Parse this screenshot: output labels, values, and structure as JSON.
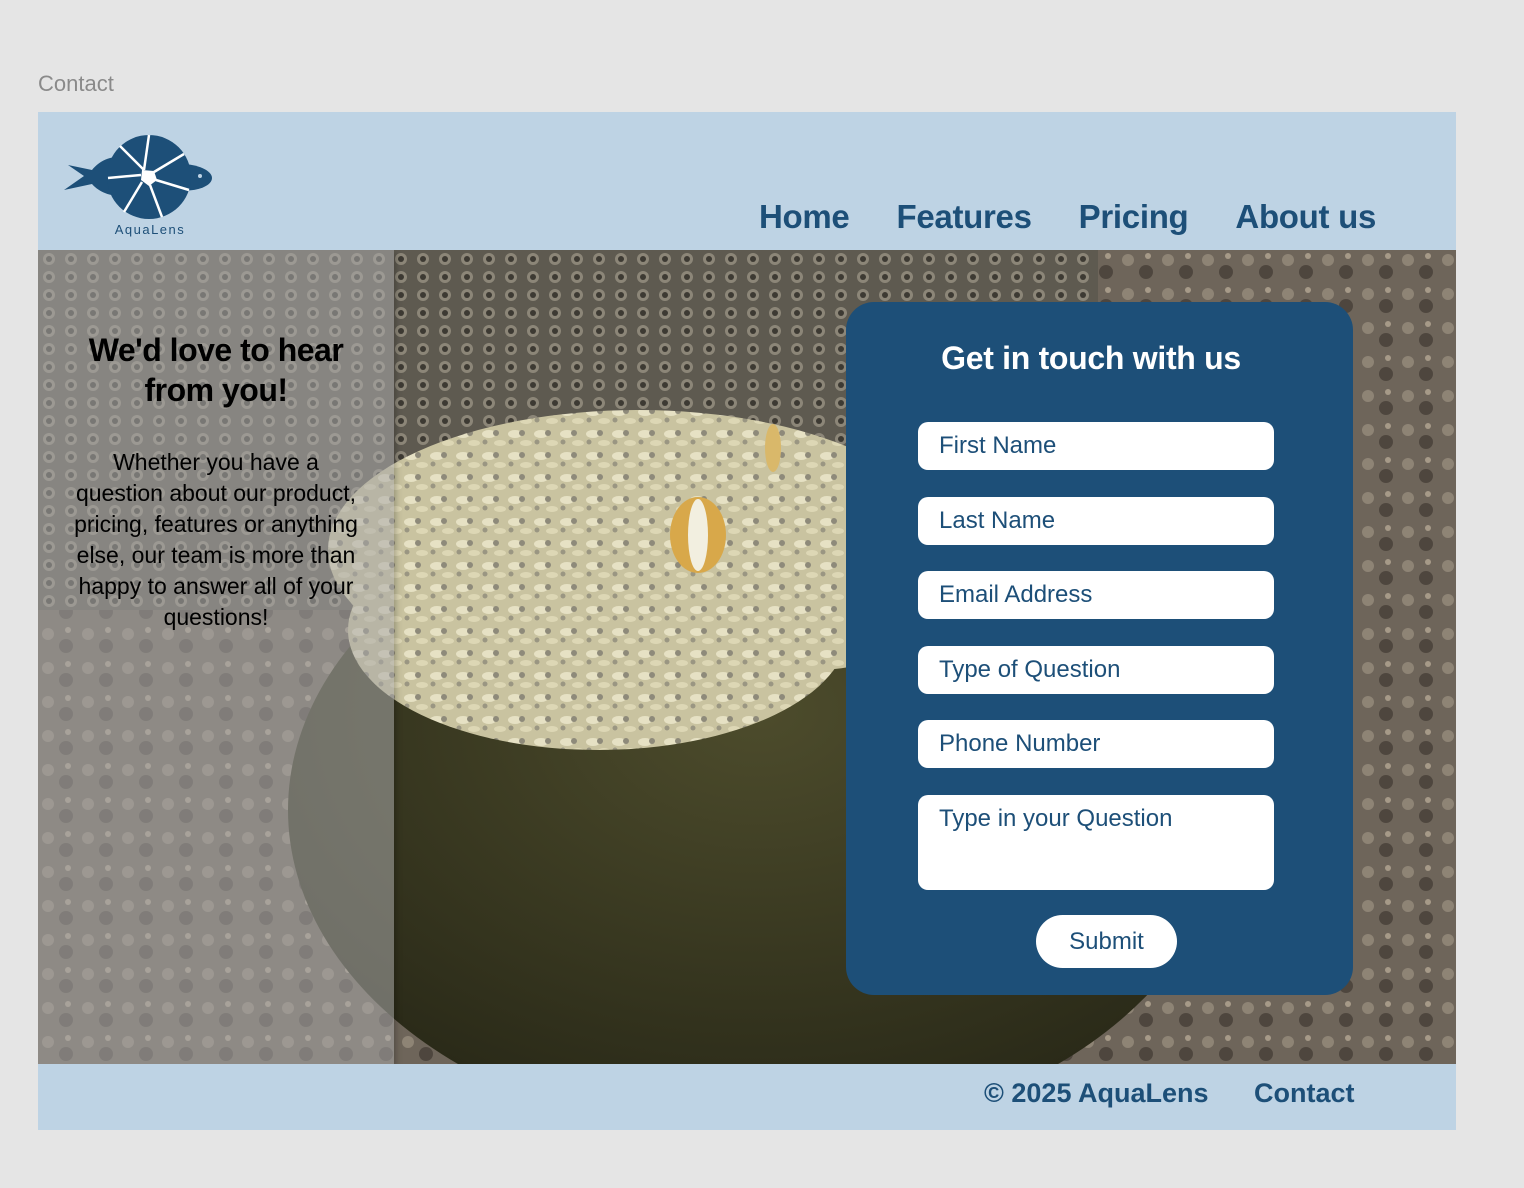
{
  "frame_label": "Contact",
  "brand": {
    "name": "AquaLens"
  },
  "nav": [
    {
      "label": "Home"
    },
    {
      "label": "Features"
    },
    {
      "label": "Pricing"
    },
    {
      "label": "About us"
    }
  ],
  "intro": {
    "heading": "We'd love to hear from you!",
    "body": "Whether you have a question about our product, pricing, features or anything else, our team is more than happy to answer all of your questions!"
  },
  "form": {
    "title": "Get in touch with us",
    "fields": [
      {
        "placeholder": "First Name"
      },
      {
        "placeholder": "Last Name"
      },
      {
        "placeholder": "Email Address"
      },
      {
        "placeholder": "Type of Question"
      },
      {
        "placeholder": "Phone Number"
      },
      {
        "placeholder": "Type in your Question"
      }
    ],
    "submit_label": "Submit"
  },
  "footer": {
    "copyright": "© 2025 AquaLens",
    "contact_label": "Contact"
  },
  "colors": {
    "brand_blue": "#1d4f78",
    "header_bg": "#bed3e4",
    "canvas_bg": "#e5e5e5"
  },
  "icons": {
    "logo": "fish-camera-shutter-logo"
  }
}
